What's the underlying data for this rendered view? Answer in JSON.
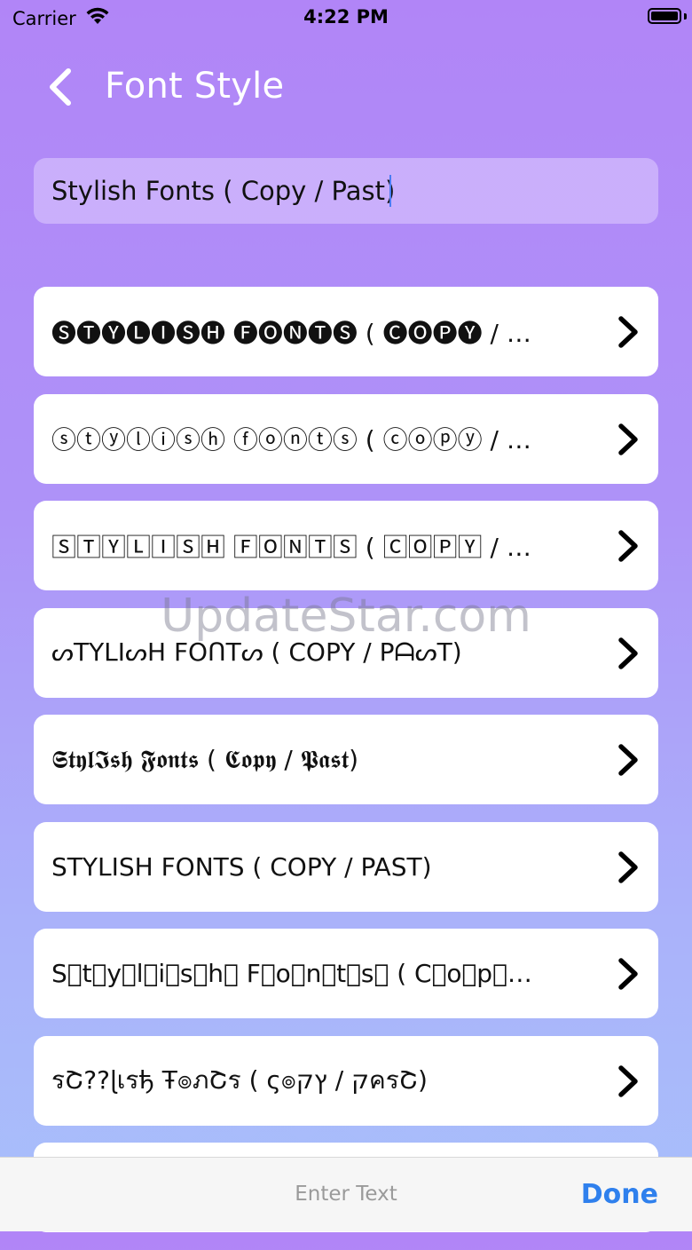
{
  "status_bar": {
    "carrier": "Carrier",
    "time": "4:22 PM",
    "wifi_icon": "wifi-icon",
    "battery_icon": "battery-icon"
  },
  "nav": {
    "title": "Font Style",
    "back_icon": "chevron-left-icon"
  },
  "input": {
    "value": "Stylish Fonts ( Copy / Past)"
  },
  "list": {
    "items": [
      {
        "text": "🅢🅣🅨🅛🅘🅢🅗 🅕🅞🅝🅣🅢 ( 🅒🅞🅟🅨 / 🅟🅐🅢🅣)"
      },
      {
        "text": "ⓢⓣⓨⓛⓘⓢⓗ ⓕⓞⓝⓣⓢ ( ⓒⓞⓟⓨ / ⓟⓐⓢⓣ)"
      },
      {
        "text": "🅂🅃🅈🄻🄸🅂🄷 🄵🄾🄽🅃🅂 ( 🄲🄾🄿🅈 / 🄿🄰🅂🅃)"
      },
      {
        "text": "ᔕTYLIᔕH FOᑎTᔕ ( COPY / PᗩᔕT)"
      },
      {
        "text": "𝕾𝖙𝖞𝖑𝕴𝖘𝖍 𝕱𝖔𝖓𝖙𝖘 ( 𝕮𝖔𝖕𝖞 / 𝕻𝖆𝖘𝖙)"
      },
      {
        "text": "STYLISH FONTS ( COPY / PAST)"
      },
      {
        "text": "S⃣t⃣y⃣l⃣i⃣s⃣h⃣ F⃣o⃣n⃣t⃣s⃣ ( C⃣o⃣p⃣y⃣ / P⃣a⃣s⃣t⃣)"
      },
      {
        "text": "รՇ??ɭเรђ Ŧ๏ภՇร ( ς๏ק / ץקครՇ)"
      },
      {
        "text": ""
      }
    ],
    "chevron_icon": "chevron-right-icon"
  },
  "bottom_bar": {
    "placeholder": "Enter Text",
    "done_label": "Done"
  },
  "watermark": "UpdateStar.com",
  "colors": {
    "gradient_top": "#b185f7",
    "gradient_bottom": "#a8c0fb",
    "done_blue": "#2f80ed",
    "card_bg": "#ffffff"
  }
}
